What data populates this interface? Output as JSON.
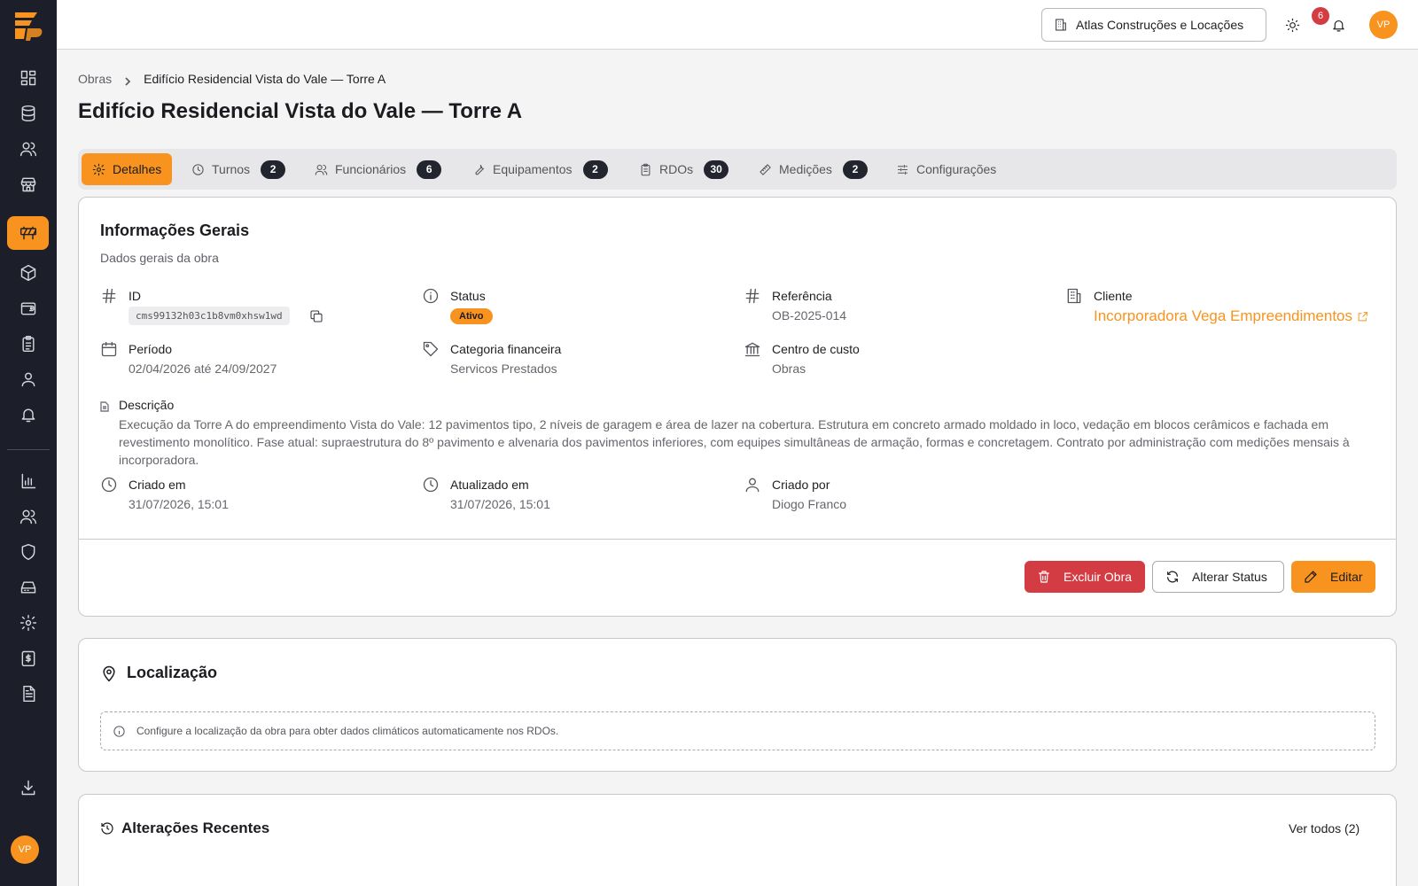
{
  "sidebar": {
    "logo": "company-logo",
    "items": [
      {
        "name": "dashboard-icon"
      },
      {
        "name": "database-icon"
      },
      {
        "name": "users-icon"
      },
      {
        "name": "store-icon"
      },
      {
        "name": "construction-icon",
        "active": true
      },
      {
        "name": "package-icon"
      },
      {
        "name": "wallet-icon"
      },
      {
        "name": "clipboard-icon"
      },
      {
        "name": "user-icon"
      },
      {
        "name": "bell-icon"
      },
      {
        "name": "bar-chart-icon"
      },
      {
        "name": "team-icon"
      },
      {
        "name": "shield-icon"
      },
      {
        "name": "hard-drive-icon"
      },
      {
        "name": "settings-icon"
      },
      {
        "name": "receipt-icon"
      },
      {
        "name": "file-text-icon"
      },
      {
        "name": "download-icon"
      }
    ],
    "avatar_initials": "VP"
  },
  "topbar": {
    "company_name": "Atlas Construções e Locações",
    "notifications_count": "6",
    "avatar_initials": "VP"
  },
  "breadcrumb": {
    "parent": "Obras",
    "current": "Edifício Residencial Vista do Vale — Torre A"
  },
  "page": {
    "title": "Edifício Residencial Vista do Vale — Torre A"
  },
  "tabs": [
    {
      "label": "Detalhes",
      "count": null,
      "active": true
    },
    {
      "label": "Turnos",
      "count": "2"
    },
    {
      "label": "Funcionários",
      "count": "6"
    },
    {
      "label": "Equipamentos",
      "count": "2"
    },
    {
      "label": "RDOs",
      "count": "30"
    },
    {
      "label": "Medições",
      "count": "2"
    },
    {
      "label": "Configurações",
      "count": null
    }
  ],
  "info": {
    "title": "Informações Gerais",
    "subtitle": "Dados gerais da obra",
    "id_label": "ID",
    "id_value": "cms99132h03c1b8vm0xhsw1wd",
    "status_label": "Status",
    "status_value": "Ativo",
    "ref_label": "Referência",
    "ref_value": "OB-2025-014",
    "client_label": "Cliente",
    "client_value": "Incorporadora Vega Empreendimentos",
    "period_label": "Período",
    "period_value": "02/04/2026 até 24/09/2027",
    "category_label": "Categoria financeira",
    "category_value": "Servicos Prestados",
    "cost_center_label": "Centro de custo",
    "cost_center_value": "Obras",
    "description_label": "Descrição",
    "description_value": "Execução da Torre A do empreendimento Vista do Vale: 12 pavimentos tipo, 2 níveis de garagem e área de lazer na cobertura. Estrutura em concreto armado moldado in loco, vedação em blocos cerâmicos e fachada em revestimento monolítico. Fase atual: supraestrutura do 8º pavimento e alvenaria dos pavimentos inferiores, com equipes simultâneas de armação, formas e concretagem. Contrato por administração com medições mensais à incorporadora.",
    "created_label": "Criado em",
    "created_value": "31/07/2026, 15:01",
    "updated_label": "Atualizado em",
    "updated_value": "31/07/2026, 15:01",
    "created_by_label": "Criado por",
    "created_by_value": "Diogo Franco"
  },
  "actions": {
    "delete_label": "Excluir Obra",
    "change_status_label": "Alterar Status",
    "edit_label": "Editar"
  },
  "location": {
    "title": "Localização",
    "note": "Configure a localização da obra para obter dados climáticos automaticamente nos RDOs."
  },
  "recent": {
    "title": "Alterações Recentes",
    "see_all": "Ver todos (2)"
  },
  "colors": {
    "accent": "#f7931e",
    "danger": "#d43c44",
    "sidebar_bg": "#1c1f2a"
  }
}
